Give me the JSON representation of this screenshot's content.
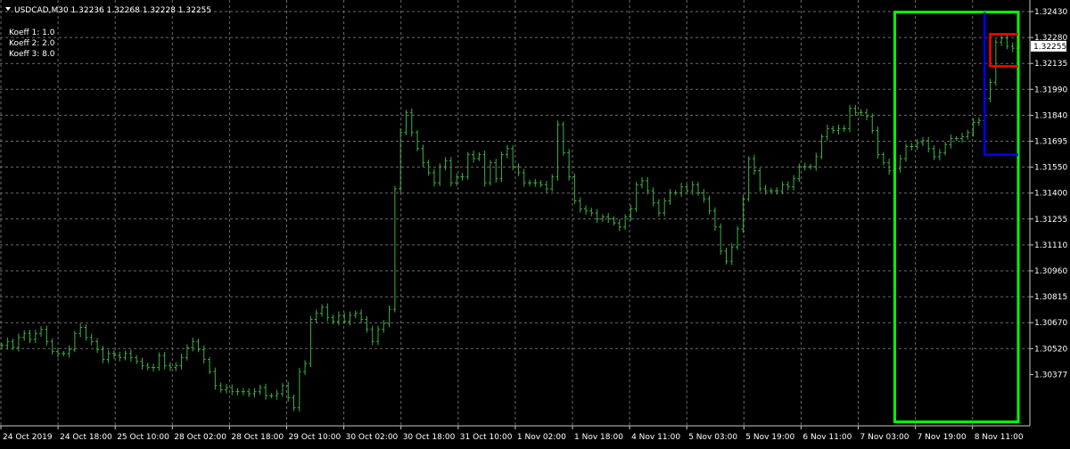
{
  "chart_data": {
    "type": "line",
    "title": "USDCAD,M30  1.32236 1.32268 1.32228 1.32255",
    "indicator_labels": [
      "Koeff 1: 1.0",
      "Koeff 2: 2.0",
      "Koeff 3: 8.0"
    ],
    "current_price": "1.32255",
    "ylim": [
      1.3037,
      1.3249
    ],
    "y_ticks": [
      "1.32430",
      "1.32280",
      "1.32135",
      "1.31990",
      "1.31840",
      "1.31695",
      "1.31550",
      "1.31400",
      "1.31255",
      "1.31110",
      "1.30960",
      "1.30815",
      "1.30670",
      "1.30520",
      "1.30377"
    ],
    "x_ticks": [
      "24 Oct 2019",
      "24 Oct 18:00",
      "25 Oct 10:00",
      "28 Oct 02:00",
      "28 Oct 18:00",
      "29 Oct 10:00",
      "30 Oct 02:00",
      "30 Oct 18:00",
      "31 Oct 10:00",
      "1 Nov 02:00",
      "1 Nov 18:00",
      "4 Nov 11:00",
      "5 Nov 03:00",
      "5 Nov 19:00",
      "6 Nov 11:00",
      "7 Nov 03:00",
      "7 Nov 19:00",
      "8 Nov 11:00"
    ],
    "series": [
      {
        "kind": "ohlc-bars",
        "color": "#3cb043",
        "close": [
          1.3077,
          1.3079,
          1.3076,
          1.3081,
          1.3083,
          1.308,
          1.3083,
          1.3085,
          1.3079,
          1.3074,
          1.3073,
          1.3073,
          1.3075,
          1.3083,
          1.3086,
          1.3081,
          1.3079,
          1.3075,
          1.307,
          1.3073,
          1.3072,
          1.3071,
          1.3073,
          1.3071,
          1.3069,
          1.3067,
          1.3066,
          1.3066,
          1.3072,
          1.3067,
          1.3066,
          1.3067,
          1.3071,
          1.3076,
          1.3079,
          1.3075,
          1.307,
          1.3064,
          1.3057,
          1.3055,
          1.3056,
          1.3054,
          1.3054,
          1.3054,
          1.3053,
          1.3054,
          1.3056,
          1.3052,
          1.3052,
          1.3053,
          1.3057,
          1.3051,
          1.3046,
          1.3064,
          1.3068,
          1.309,
          1.3093,
          1.3096,
          1.3091,
          1.3089,
          1.3092,
          1.3089,
          1.3092,
          1.3093,
          1.309,
          1.3085,
          1.3079,
          1.3085,
          1.3088,
          1.3095,
          1.3155,
          1.3183,
          1.3193,
          1.3183,
          1.3175,
          1.3168,
          1.3163,
          1.3158,
          1.3166,
          1.3169,
          1.3158,
          1.3161,
          1.3161,
          1.3172,
          1.317,
          1.3172,
          1.3158,
          1.3168,
          1.316,
          1.3172,
          1.3175,
          1.3166,
          1.3163,
          1.3158,
          1.3158,
          1.3158,
          1.3157,
          1.3155,
          1.3161,
          1.3187,
          1.3173,
          1.3161,
          1.3149,
          1.3145,
          1.3144,
          1.3143,
          1.314,
          1.3141,
          1.314,
          1.3138,
          1.3136,
          1.3141,
          1.3145,
          1.3157,
          1.3159,
          1.3154,
          1.3148,
          1.3143,
          1.3149,
          1.3153,
          1.3153,
          1.3156,
          1.3154,
          1.3157,
          1.3153,
          1.315,
          1.3144,
          1.3136,
          1.3124,
          1.3119,
          1.3126,
          1.3135,
          1.315,
          1.317,
          1.3164,
          1.3155,
          1.3154,
          1.3154,
          1.3154,
          1.3157,
          1.3156,
          1.316,
          1.3166,
          1.3166,
          1.3166,
          1.3171,
          1.3181,
          1.3185,
          1.3184,
          1.3185,
          1.3185,
          1.3195,
          1.3193,
          1.3193,
          1.3191,
          1.3184,
          1.3172,
          1.3168,
          1.3164,
          1.3165,
          1.317,
          1.3176,
          1.3176,
          1.3178,
          1.3179,
          1.3175,
          1.3171,
          1.3173,
          1.3177,
          1.318,
          1.318,
          1.3181,
          1.3183,
          1.3188,
          1.3189,
          1.32,
          1.3208,
          1.3228,
          1.323,
          1.3226,
          1.3225,
          1.3226
        ]
      }
    ],
    "annotations": [
      {
        "name": "range-box-green",
        "color": "#00ff00",
        "y_top": 1.3243,
        "y_bottom": 1.3039,
        "from_bar": 159,
        "to_bar": 181
      },
      {
        "name": "range-box-blue",
        "color": "#0000ff",
        "y_top": 1.3243,
        "y_bottom": 1.3172,
        "from_bar": 175,
        "to_bar": 181
      },
      {
        "name": "range-box-red",
        "color": "#ff0000",
        "y_top": 1.3232,
        "y_bottom": 1.3216,
        "from_bar": 176,
        "to_bar": 181
      }
    ]
  }
}
